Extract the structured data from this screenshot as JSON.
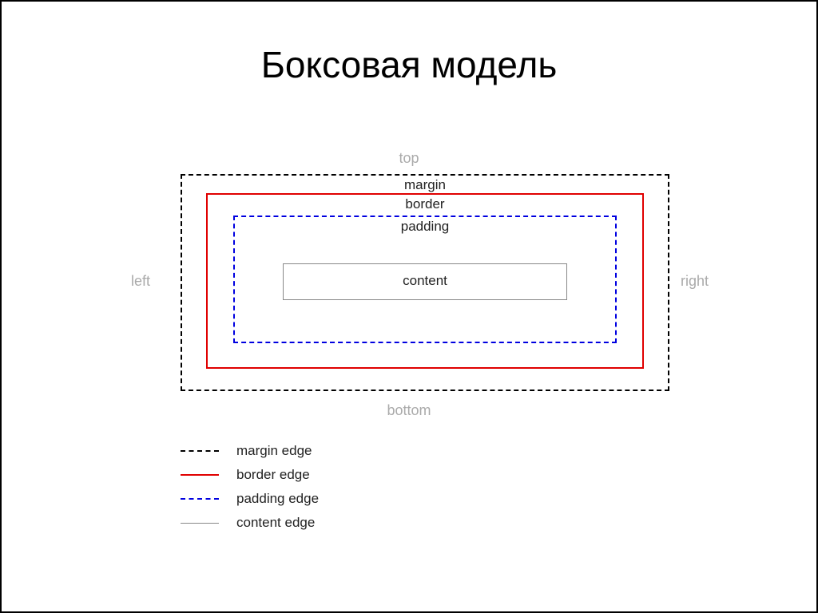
{
  "title": "Боксовая модель",
  "sides": {
    "top": "top",
    "right": "right",
    "bottom": "bottom",
    "left": "left"
  },
  "boxes": {
    "margin": "margin",
    "border": "border",
    "padding": "padding",
    "content": "content"
  },
  "legend": {
    "margin": "margin edge",
    "border": "border edge",
    "padding": "padding edge",
    "content": "content edge"
  },
  "colors": {
    "margin_edge": "#000000",
    "border_edge": "#e00000",
    "padding_edge": "#0000e0",
    "content_edge": "#888888",
    "side_label": "#aaaaaa"
  }
}
